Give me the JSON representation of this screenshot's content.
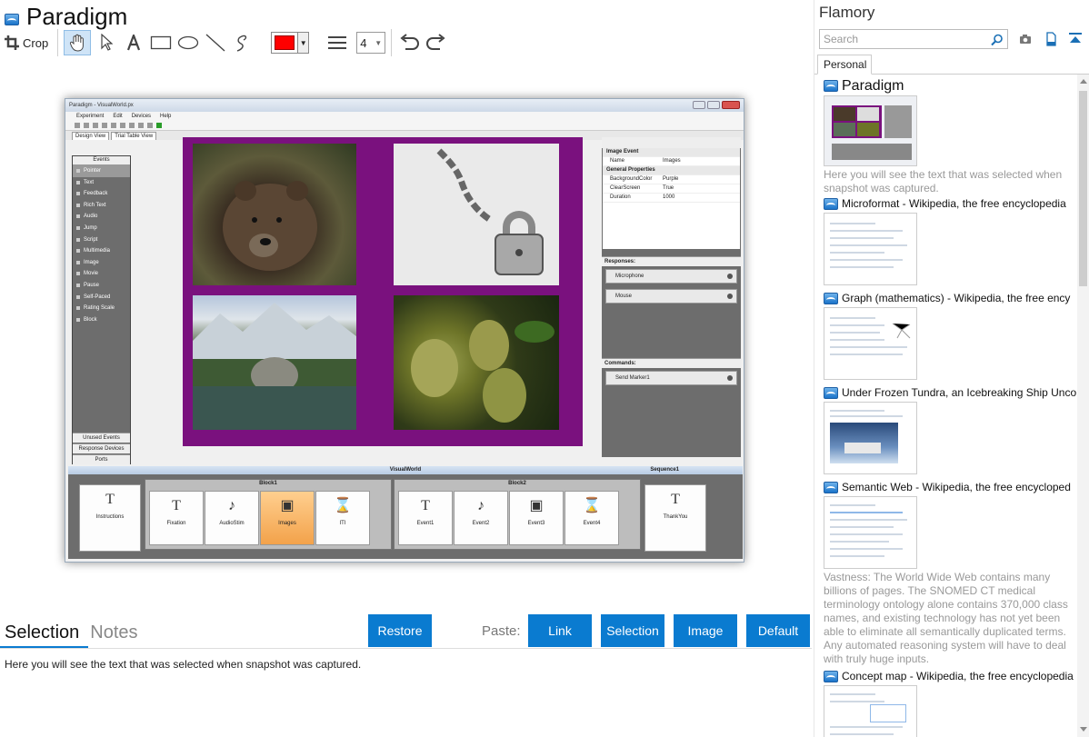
{
  "app": {
    "title": "Paradigm",
    "icon": "paradigm-app-icon"
  },
  "toolbar": {
    "crop_label": "Crop",
    "line_width": "4",
    "color": "#ff0000",
    "tools": [
      "crop-icon",
      "hand-icon",
      "pointer-icon",
      "text-icon",
      "rectangle-icon",
      "ellipse-icon",
      "line-icon",
      "freehand-icon",
      "line-width-icon",
      "undo-icon",
      "redo-icon"
    ]
  },
  "screenshot": {
    "window_title": "Paradigm - VisualWorld.px",
    "menu": [
      "Experiment",
      "Edit",
      "Devices",
      "Help"
    ],
    "tabs": [
      "Design View",
      "Trial Table View"
    ],
    "events_header": "Events",
    "events": [
      "Pointer",
      "Text",
      "Feedback",
      "Rich Text",
      "Audio",
      "Jump",
      "Script",
      "Multimedia",
      "Image",
      "Movie",
      "Pause",
      "Self-Paced",
      "Rating Scale",
      "Block"
    ],
    "events_footer": [
      "Unused Events",
      "Response Devices",
      "Ports"
    ],
    "properties": {
      "section": "Image Event",
      "name_label": "Name",
      "name_value": "Images",
      "general": "General Properties",
      "rows": [
        {
          "label": "BackgroundColor",
          "value": "Purple"
        },
        {
          "label": "ClearScreen",
          "value": "True"
        },
        {
          "label": "Duration",
          "value": "1000"
        }
      ]
    },
    "responses_title": "Responses:",
    "responses": [
      "Microphone",
      "Mouse"
    ],
    "commands_title": "Commands:",
    "commands": [
      "Send Marker1"
    ],
    "timeline_title": "VisualWorld",
    "sequence_label": "Sequence1",
    "block1": "Block1",
    "block2": "Block2",
    "timeline_items": [
      "Instructions",
      "Fixation",
      "AudioStim",
      "Images",
      "ITI",
      "Event1",
      "Event2",
      "Event3",
      "Event4",
      "ThankYou"
    ],
    "stage_color": "#7a117e"
  },
  "bottom": {
    "tabs": [
      "Selection",
      "Notes"
    ],
    "active_tab": "Selection",
    "restore": "Restore",
    "paste_label": "Paste:",
    "paste_buttons": [
      "Link",
      "Selection",
      "Image",
      "Default"
    ],
    "selection_text": "Here you will see the text that was selected when snapshot was captured.",
    "accent": "#0a7bd0"
  },
  "flamory": {
    "title": "Flamory",
    "search_placeholder": "Search",
    "tab": "Personal",
    "entries": [
      {
        "title": "Paradigm",
        "desc": "Here you will see the text that was selected when snapshot was captured."
      },
      {
        "title": "Microformat - Wikipedia, the free encyclopedia",
        "desc": ""
      },
      {
        "title": "Graph (mathematics) - Wikipedia, the free ency",
        "desc": ""
      },
      {
        "title": "Under Frozen Tundra, an Icebreaking Ship Unco",
        "desc": ""
      },
      {
        "title": "Semantic Web - Wikipedia, the free encycloped",
        "desc": "Vastness: The World Wide Web contains many billions of pages. The SNOMED CT medical terminology ontology alone contains 370,000 class names, and existing technology has not yet been able to eliminate all semantically duplicated terms. Any automated reasoning system will have to deal with truly huge inputs."
      },
      {
        "title": "Concept map - Wikipedia, the free encyclopedia",
        "desc": ""
      }
    ]
  }
}
